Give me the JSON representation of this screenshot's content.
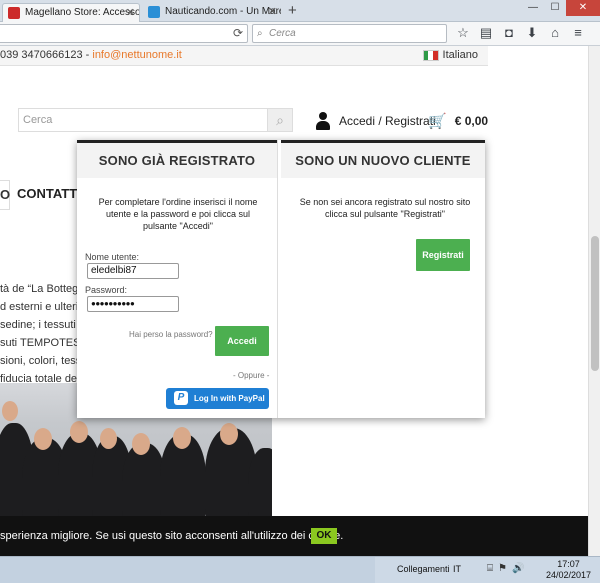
{
  "browser": {
    "tabs": [
      {
        "label": "Magellano Store: Accessori...",
        "color": "#cc2a2a",
        "active": true
      },
      {
        "label": "Nauticando.com - Un Mare...",
        "color": "#2a8fd6",
        "active": false
      }
    ],
    "new_tab": "+",
    "window_controls": {
      "minimize": "—",
      "maximize": "☐",
      "close": "✕"
    },
    "reload_icon": "⟳",
    "search_placeholder": "Cerca",
    "nav_icons": [
      "star-icon",
      "reading-list-icon",
      "pocket-icon",
      "download-icon",
      "home-icon",
      "menu-icon"
    ]
  },
  "page": {
    "phone": "039 3470666123 - ",
    "email": "info@nettunome.it",
    "language": "Italiano",
    "search_placeholder": "Cerca",
    "account_link": "Accedi / Registrati",
    "cart_total": "€ 0,00",
    "menu_fragment": "O",
    "menu_contact": "CONTATT",
    "body_lines": [
      "tà de “La Bottega",
      "d esterni e ulteri",
      "sedine; i tessuti c",
      "suti TEMPOTEST",
      "sioni, colori, tess",
      "fiducia totale de"
    ]
  },
  "login": {
    "registered": {
      "title": "SONO GIÀ REGISTRATO",
      "instructions": "Per completare l'ordine inserisci il nome utente e la password e poi clicca sul pulsante \"Accedi\"",
      "username_label": "Nome utente:",
      "username_value": "eledelbi87",
      "password_label": "Password:",
      "password_value": "●●●●●●●●●●",
      "forgot_link": "Hai perso la password?",
      "login_button": "Accedi",
      "or_text": "- Oppure -",
      "paypal_button": "Log In with PayPal"
    },
    "new_customer": {
      "title": "SONO UN NUOVO CLIENTE",
      "instructions": "Se non sei ancora registrato sul nostro sito clicca sul pulsante \"Registrati\"",
      "register_button": "Registrati"
    }
  },
  "cookie": {
    "message": "sperienza migliore. Se usi questo sito acconsenti all'utilizzo dei cookie.",
    "ok_button": "OK"
  },
  "taskbar": {
    "links_label": "Collegamenti",
    "language": "IT",
    "time": "17:07",
    "date": "24/02/2017"
  },
  "colors": {
    "accent_orange": "#e8792b",
    "button_green": "#4caf50",
    "paypal_blue": "#1f7fd4",
    "cookie_ok": "#8bc820"
  }
}
